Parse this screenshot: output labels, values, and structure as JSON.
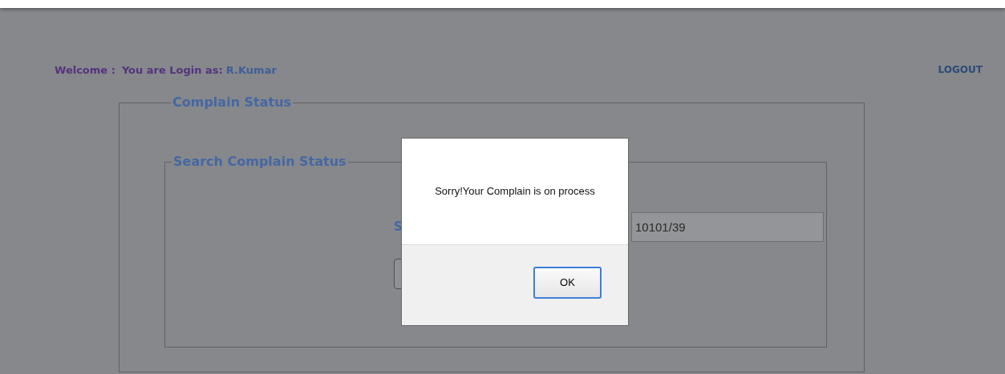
{
  "header": {
    "welcome": "Welcome :",
    "login_label": "You are Login as:",
    "user": "R.Kumar",
    "logout": "LOGOUT"
  },
  "panel": {
    "title": "Complain Status",
    "search": {
      "title": "Search Complain Status",
      "field_label": "S",
      "field_value": "10101/39"
    }
  },
  "dialog": {
    "message": "Sorry!Your Complain is on process",
    "button": "OK"
  }
}
